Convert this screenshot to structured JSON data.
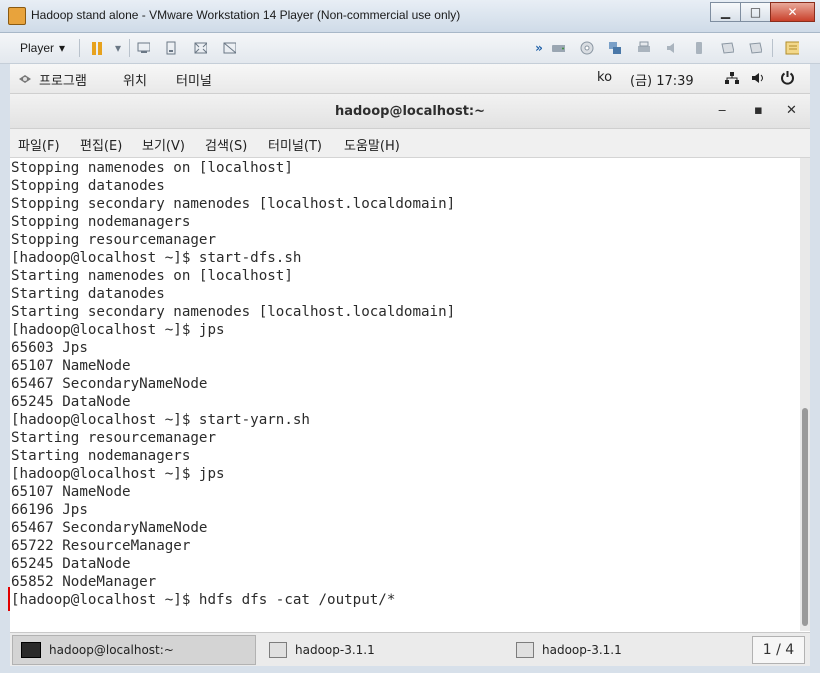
{
  "vm_window": {
    "title": "Hadoop stand alone - VMware Workstation 14 Player (Non-commercial use only)",
    "minimize": "▁",
    "maximize": "□",
    "close": "✕"
  },
  "vm_toolbar": {
    "player_label": "Player",
    "player_caret": "▾",
    "pause_caret": "▾",
    "more_glyph": "»"
  },
  "gnome_bar": {
    "applications": "프로그램",
    "places": "위치",
    "terminal": "터미널",
    "input_method": "ko",
    "clock": "(금) 17:39"
  },
  "terminal": {
    "title": "hadoop@localhost:~",
    "minimize": "‒",
    "maximize": "▪",
    "close": "✕",
    "menu": [
      "파일(F)",
      "편집(E)",
      "보기(V)",
      "검색(S)",
      "터미널(T)",
      "도움말(H)"
    ],
    "lines": [
      "Stopping namenodes on [localhost]",
      "Stopping datanodes",
      "Stopping secondary namenodes [localhost.localdomain]",
      "Stopping nodemanagers",
      "Stopping resourcemanager",
      "[hadoop@localhost ~]$ start-dfs.sh",
      "Starting namenodes on [localhost]",
      "Starting datanodes",
      "Starting secondary namenodes [localhost.localdomain]",
      "[hadoop@localhost ~]$ jps",
      "65603 Jps",
      "65107 NameNode",
      "65467 SecondaryNameNode",
      "65245 DataNode",
      "[hadoop@localhost ~]$ start-yarn.sh",
      "Starting resourcemanager",
      "Starting nodemanagers",
      "[hadoop@localhost ~]$ jps",
      "65107 NameNode",
      "66196 Jps",
      "65467 SecondaryNameNode",
      "65722 ResourceManager",
      "65245 DataNode",
      "65852 NodeManager",
      "[hadoop@localhost ~]$ hdfs dfs -cat /output/*"
    ]
  },
  "taskbar": {
    "tasks": [
      "hadoop@localhost:~",
      "hadoop-3.1.1",
      "hadoop-3.1.1"
    ],
    "pager": "1 / 4"
  }
}
